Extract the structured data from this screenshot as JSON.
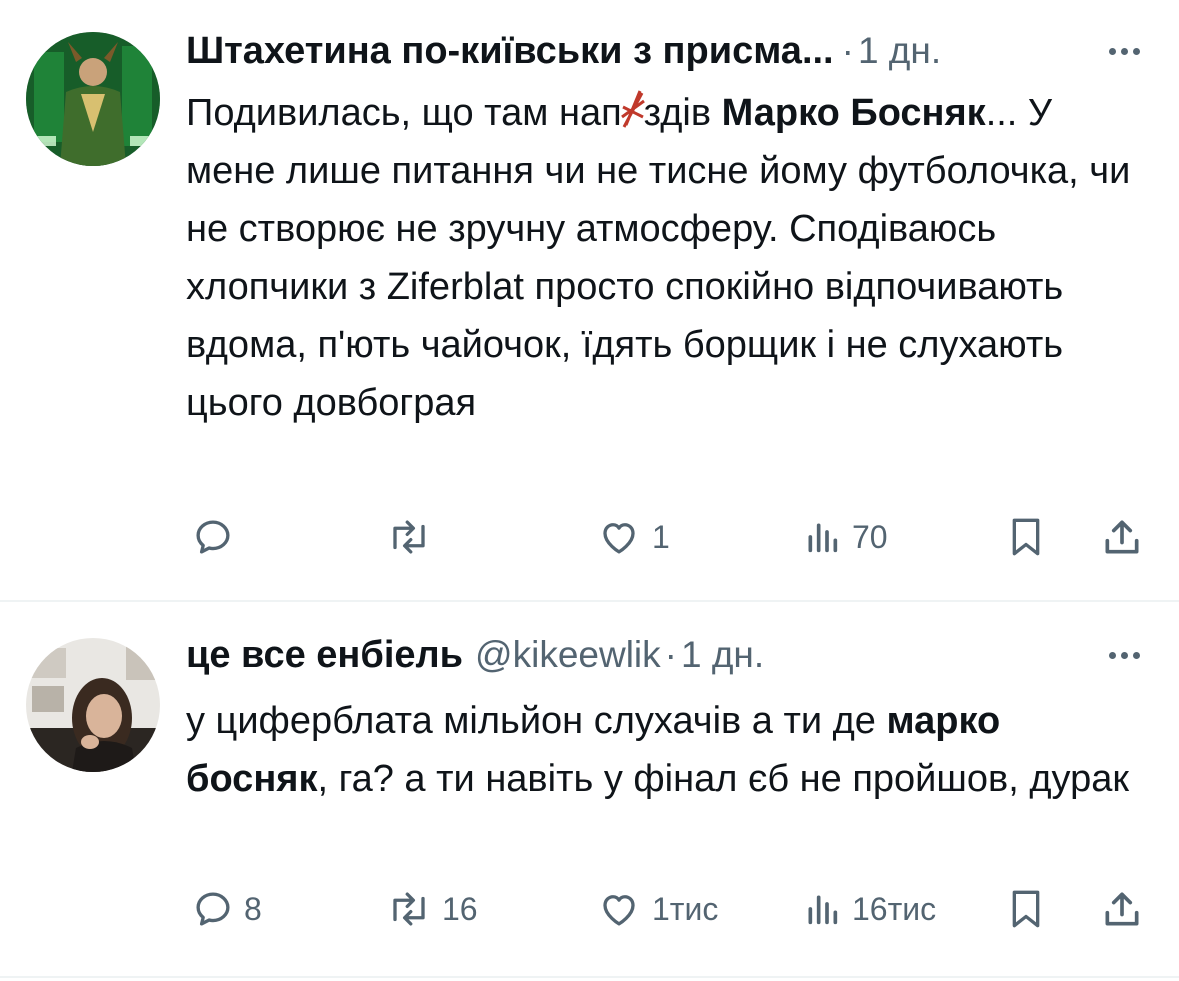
{
  "posts": [
    {
      "display_name": "Штахетина по-київськи з присма...",
      "handle": "",
      "separator": "·",
      "time": "1 дн.",
      "text_parts": {
        "p1": "Подивилась,  що там нап",
        "p1_scribbled": "...",
        "p2": "здів ",
        "bold1": "Марко Босняк",
        "p3": "... У мене лише питання чи не тисне йому футболочка, чи не створює не зручну атмосферу. Сподіваюсь хлопчики з Ziferblat просто спокійно відпочивають вдома, п'ють чайочок, їдять борщик і не слухають цього довбограя"
      },
      "actions": {
        "reply_count": "",
        "repost_count": "",
        "like_count": "1",
        "views_count": "70"
      }
    },
    {
      "display_name": "це все енбіель",
      "handle": "@kikeewlik",
      "separator": "·",
      "time": "1 дн.",
      "text_parts": {
        "p1": "у циферблата мільйон слухачів а ти де ",
        "bold1": "марко босняк",
        "p2": ", га? а ти навіть у фінал єб не пройшов, дурак"
      },
      "actions": {
        "reply_count": "8",
        "repost_count": "16",
        "like_count": "1тис",
        "views_count": "16тис"
      }
    }
  ],
  "colors": {
    "text": "#0f1419",
    "secondary": "#536471",
    "divider": "#eff3f4",
    "scribble": "#c0392b"
  },
  "icons": [
    "reply-icon",
    "repost-icon",
    "like-icon",
    "views-icon",
    "bookmark-icon",
    "share-icon",
    "more-icon"
  ]
}
